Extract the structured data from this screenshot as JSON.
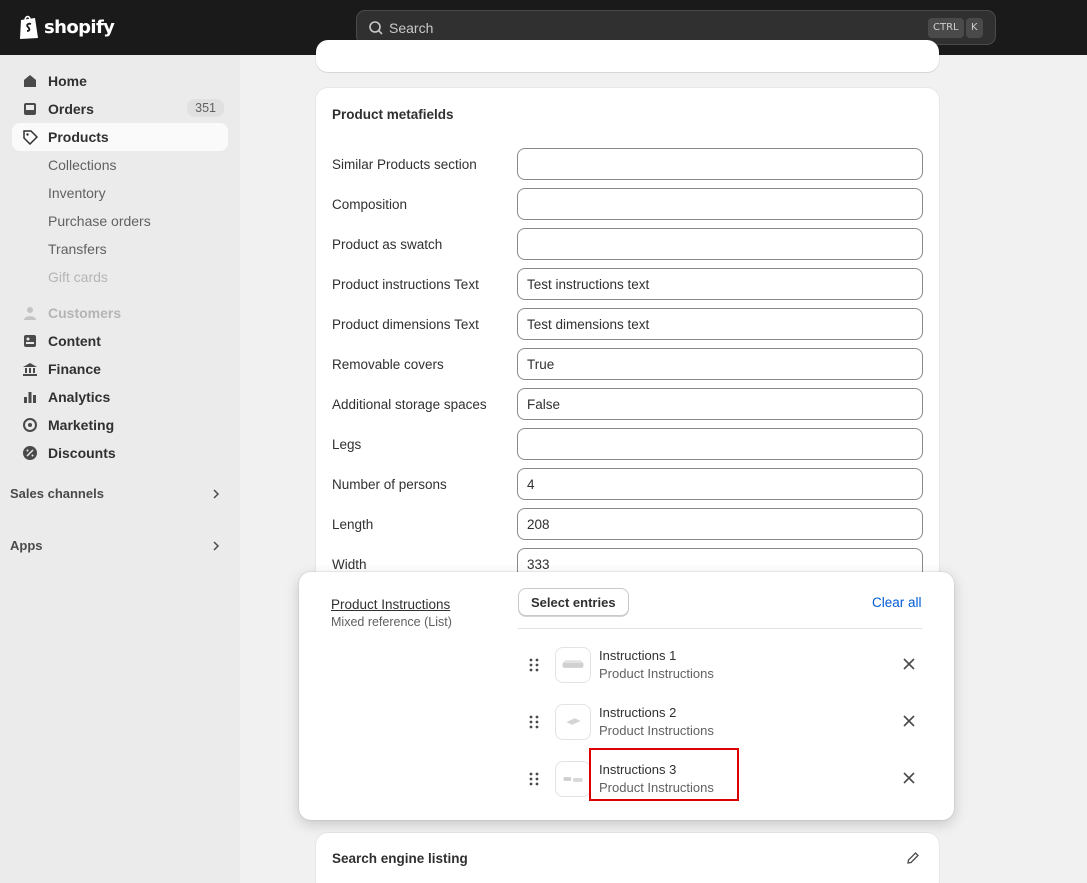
{
  "topbar": {
    "logo_text": "shopify",
    "search_placeholder": "Search",
    "shortcut_key1": "CTRL",
    "shortcut_key2": "K"
  },
  "sidebar": {
    "home": "Home",
    "orders": "Orders",
    "orders_count": "351",
    "products": "Products",
    "collections": "Collections",
    "inventory": "Inventory",
    "purchase_orders": "Purchase orders",
    "transfers": "Transfers",
    "gift_cards": "Gift cards",
    "customers": "Customers",
    "content": "Content",
    "finance": "Finance",
    "analytics": "Analytics",
    "marketing": "Marketing",
    "discounts": "Discounts",
    "sales_channels": "Sales channels",
    "apps": "Apps"
  },
  "metafields": {
    "title": "Product metafields",
    "rows": [
      {
        "label": "Similar Products section",
        "value": ""
      },
      {
        "label": "Composition",
        "value": ""
      },
      {
        "label": "Product as swatch",
        "value": ""
      },
      {
        "label": "Product instructions Text",
        "value": "Test instructions text"
      },
      {
        "label": "Product dimensions Text",
        "value": "Test dimensions text"
      },
      {
        "label": "Removable covers",
        "value": "True"
      },
      {
        "label": "Additional storage spaces",
        "value": "False"
      },
      {
        "label": "Legs",
        "value": ""
      },
      {
        "label": "Number of persons",
        "value": "4"
      },
      {
        "label": "Length",
        "value": "208"
      },
      {
        "label": "Width",
        "value": "333"
      }
    ]
  },
  "instructions_field": {
    "title": "Product Instructions",
    "subtitle": "Mixed reference (List)",
    "select_button": "Select entries",
    "clear_all": "Clear all",
    "entries": [
      {
        "title": "Instructions 1",
        "type": "Product Instructions"
      },
      {
        "title": "Instructions 2",
        "type": "Product Instructions"
      },
      {
        "title": "Instructions 3",
        "type": "Product Instructions"
      }
    ]
  },
  "seo": {
    "title": "Search engine listing"
  }
}
